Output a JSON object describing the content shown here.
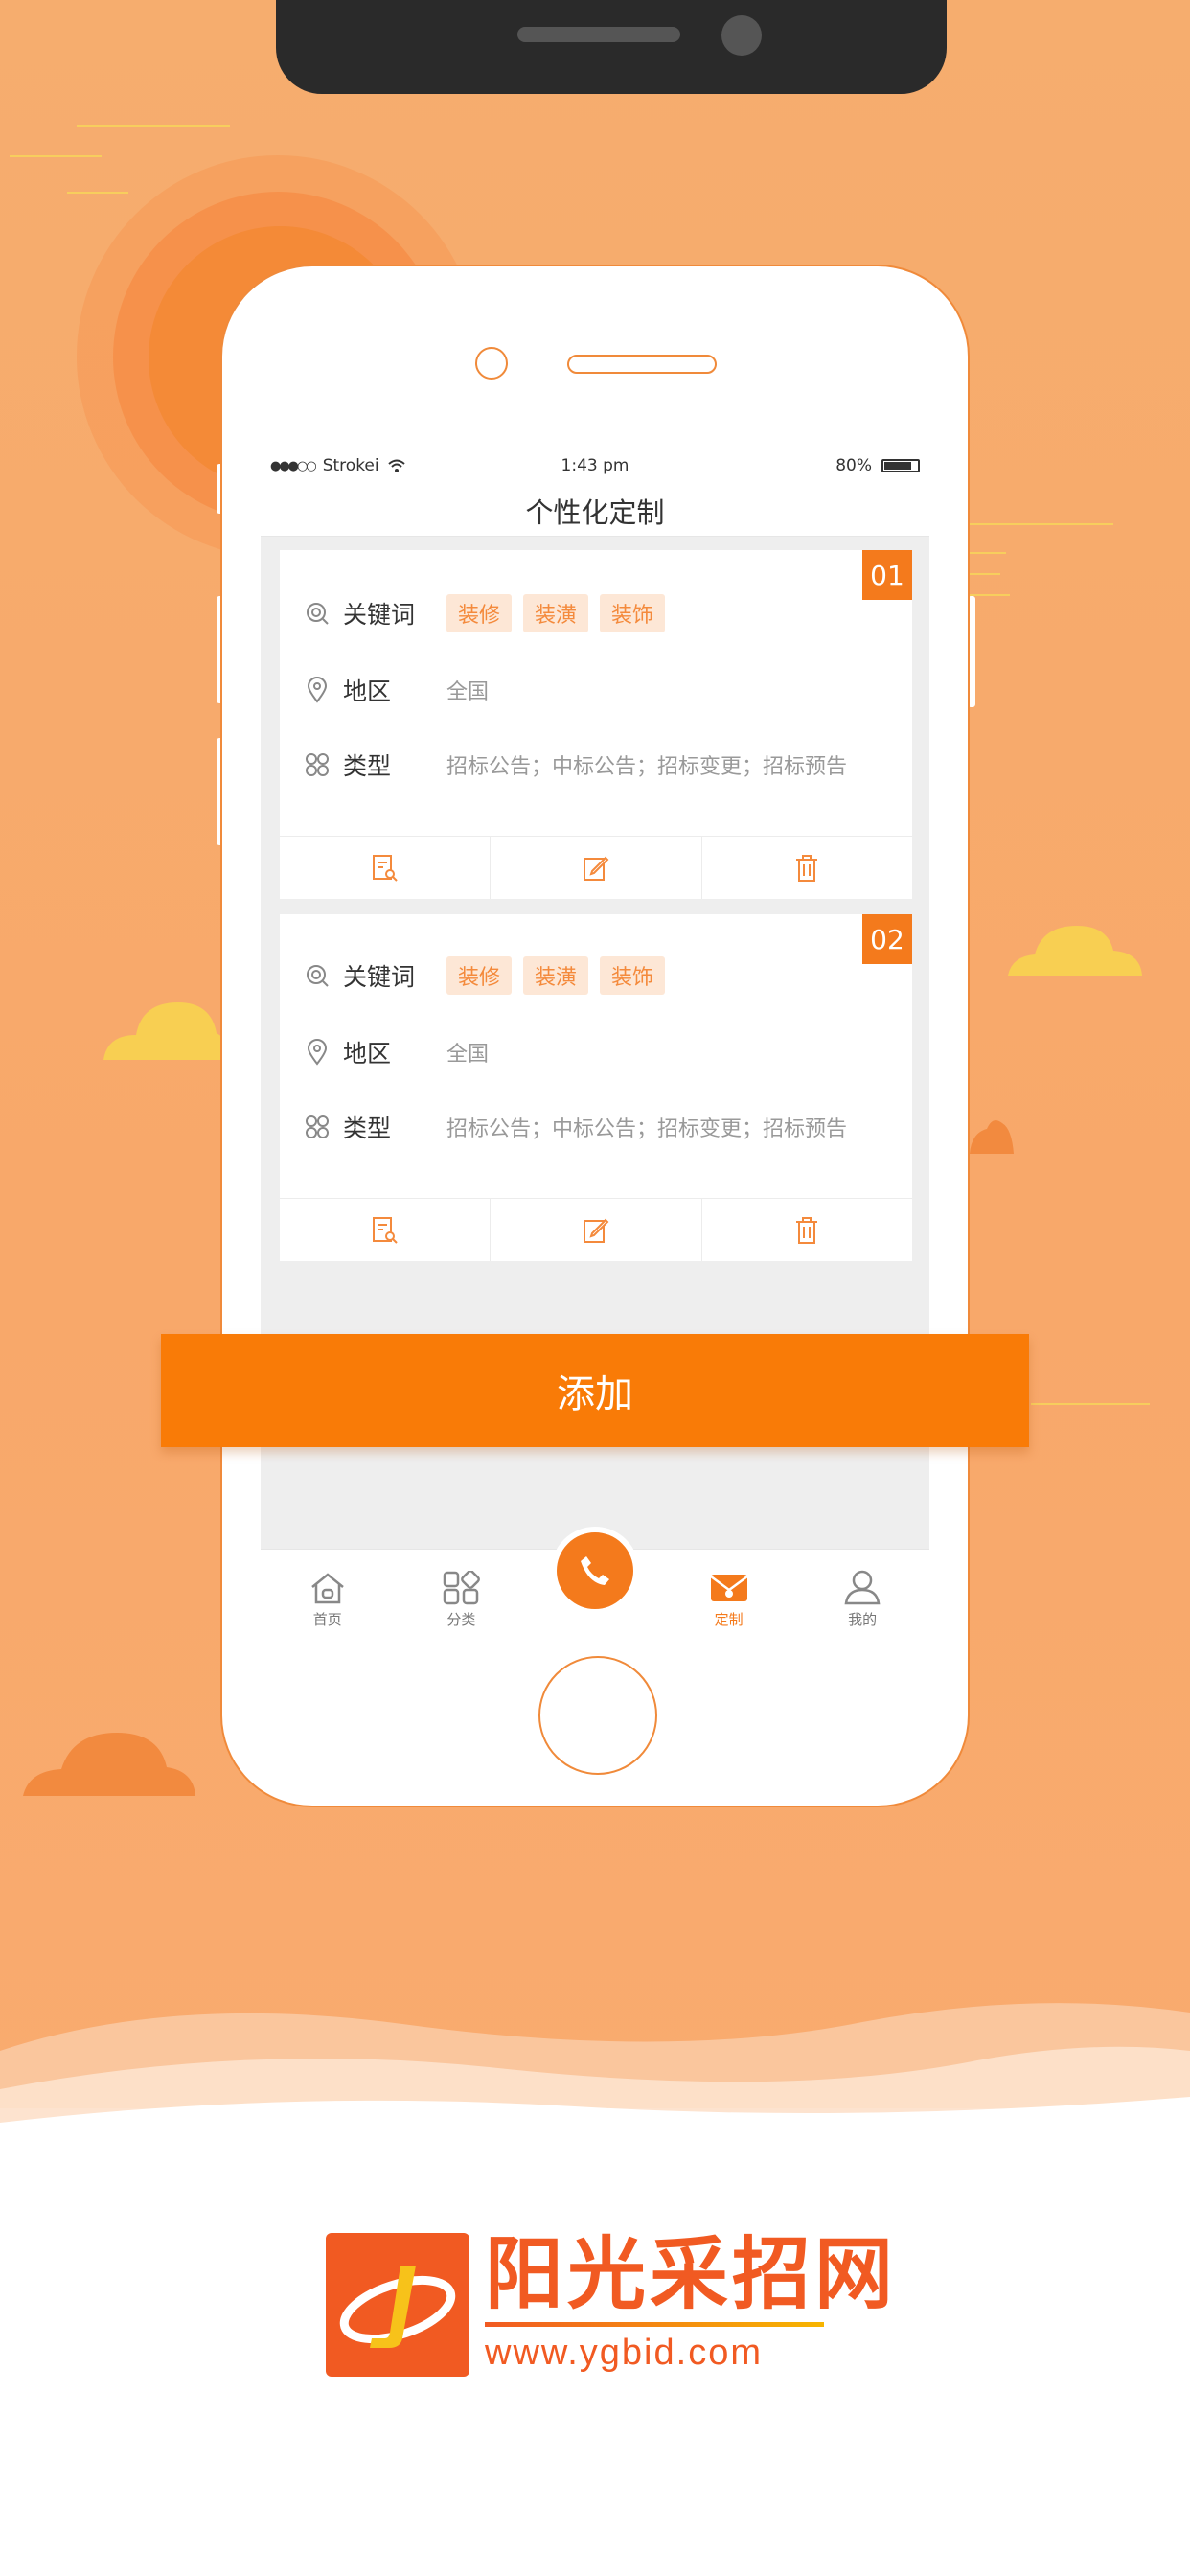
{
  "status_bar": {
    "carrier": "Strokei",
    "time": "1:43 pm",
    "battery": "80%"
  },
  "nav": {
    "title": "个性化定制"
  },
  "cards": [
    {
      "badge": "01",
      "keyword_label": "关键词",
      "tags": [
        "装修",
        "装潢",
        "装饰"
      ],
      "region_label": "地区",
      "region_value": "全国",
      "type_label": "类型",
      "type_value": "招标公告；中标公告；招标变更；招标预告"
    },
    {
      "badge": "02",
      "keyword_label": "关键词",
      "tags": [
        "装修",
        "装潢",
        "装饰"
      ],
      "region_label": "地区",
      "region_value": "全国",
      "type_label": "类型",
      "type_value": "招标公告；中标公告；招标变更；招标预告"
    }
  ],
  "add_button": {
    "label": "添加"
  },
  "tabbar": {
    "items": [
      {
        "label": "首页",
        "icon": "home-icon"
      },
      {
        "label": "分类",
        "icon": "grid-icon"
      },
      {
        "label": "",
        "icon": "phone-icon"
      },
      {
        "label": "定制",
        "icon": "mail-icon"
      },
      {
        "label": "我的",
        "icon": "user-icon"
      }
    ],
    "active": "定制"
  },
  "brand": {
    "name": "阳光采招网",
    "url": "www.ygbid.com"
  },
  "colors": {
    "accent": "#f47a1c",
    "background": "#f8aa6c",
    "tag_bg": "#fde7d6"
  }
}
